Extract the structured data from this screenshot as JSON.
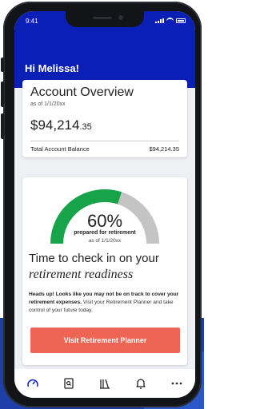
{
  "status_bar": {
    "time": "9:41"
  },
  "greeting": "Hi Melissa!",
  "account": {
    "title": "Account Overview",
    "as_of": "as of 1/1/20xx",
    "balance_main": "$94,214",
    "balance_cents": ".35",
    "total_label": "Total Account Balance",
    "total_value": "$94,214.35"
  },
  "retirement": {
    "percent_label": "60%",
    "percent_value": 0.6,
    "prepared_label": "prepared for retirement",
    "as_of": "as of 1/1/20xx",
    "headline": "Time to check in on your",
    "headline_italic": "retirement readiness",
    "message_bold": "Heads up! Looks like you may not be on track to cover your retirement expenses.",
    "message_rest": " Visit your Retirement Planner and take control of your future today.",
    "cta_label": "Visit Retirement Planner",
    "gauge_colors": {
      "filled": "#17a34a",
      "empty": "#c4c4c4"
    }
  },
  "colors": {
    "header": "#0a1fb5",
    "cta": "#ef6555"
  },
  "tabbar": {
    "items": [
      {
        "icon": "gauge-icon"
      },
      {
        "icon": "document-search-icon"
      },
      {
        "icon": "library-icon"
      },
      {
        "icon": "bell-icon"
      },
      {
        "icon": "more-icon"
      }
    ]
  }
}
